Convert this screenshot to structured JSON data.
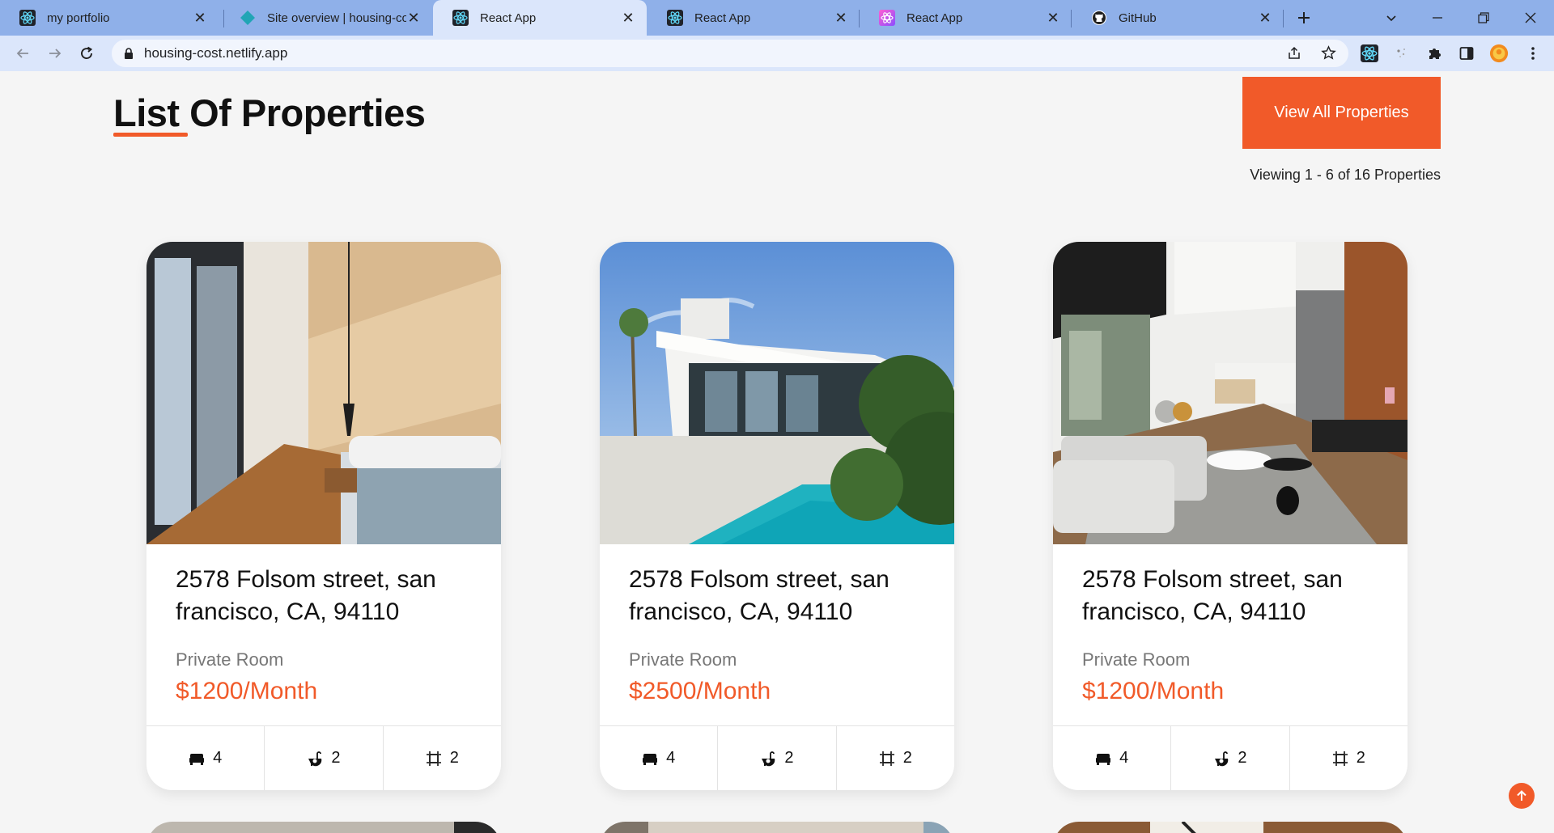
{
  "browser": {
    "tabs": [
      {
        "title": "my portfolio",
        "favicon": "react-icon"
      },
      {
        "title": "Site overview | housing-cost",
        "favicon": "netlify-icon"
      },
      {
        "title": "React App",
        "favicon": "react-icon",
        "active": true
      },
      {
        "title": "React App",
        "favicon": "react-icon"
      },
      {
        "title": "React App",
        "favicon": "react-gradient-icon"
      },
      {
        "title": "GitHub",
        "favicon": "github-icon"
      }
    ],
    "url": "housing-cost.netlify.app"
  },
  "page": {
    "title": "List Of Properties",
    "view_all_label": "View All Properties",
    "viewing_text": "Viewing 1 - 6 of 16 Properties",
    "accent_color": "#f15a29"
  },
  "properties": [
    {
      "address": "2578 Folsom street, san francisco, CA, 94110",
      "type": "Private Room",
      "price": "$1200/Month",
      "beds": "4",
      "baths": "2",
      "area": "2",
      "photo": "bedroom"
    },
    {
      "address": "2578 Folsom street, san francisco, CA, 94110",
      "type": "Private Room",
      "price": "$2500/Month",
      "beds": "4",
      "baths": "2",
      "area": "2",
      "photo": "villa-pool"
    },
    {
      "address": "2578 Folsom street, san francisco, CA, 94110",
      "type": "Private Room",
      "price": "$1200/Month",
      "beds": "4",
      "baths": "2",
      "area": "2",
      "photo": "living-room"
    }
  ]
}
